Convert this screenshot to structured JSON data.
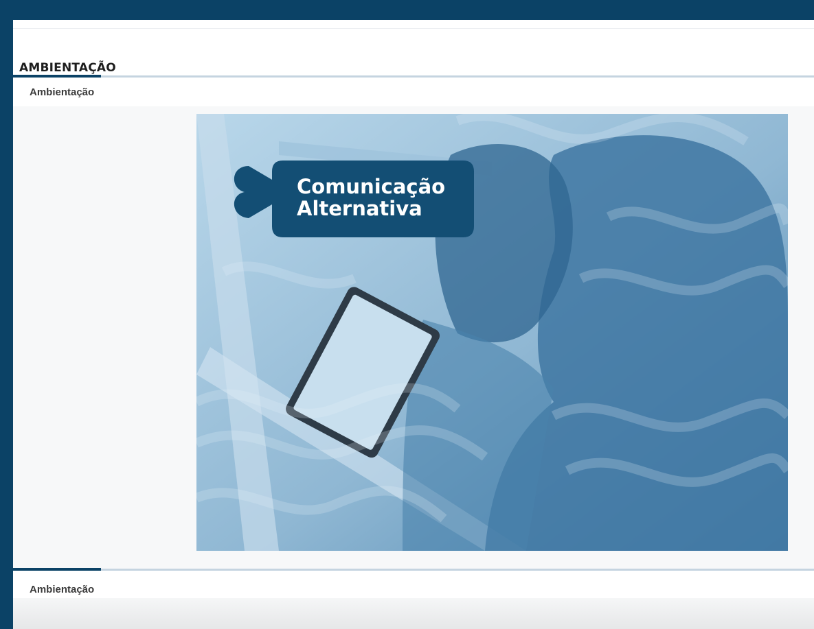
{
  "page": {
    "title": "AMBIENTAÇÃO"
  },
  "tabs": [
    {
      "label": "Ambientação"
    },
    {
      "label": "Ambientação"
    }
  ],
  "banner": {
    "line1": "Comunicação",
    "line2": "Alternativa"
  },
  "colors": {
    "frame": "#0b4266",
    "tab_active": "#0b4266",
    "tab_rule": "#c5d4e0",
    "banner_badge": "#134e74"
  }
}
